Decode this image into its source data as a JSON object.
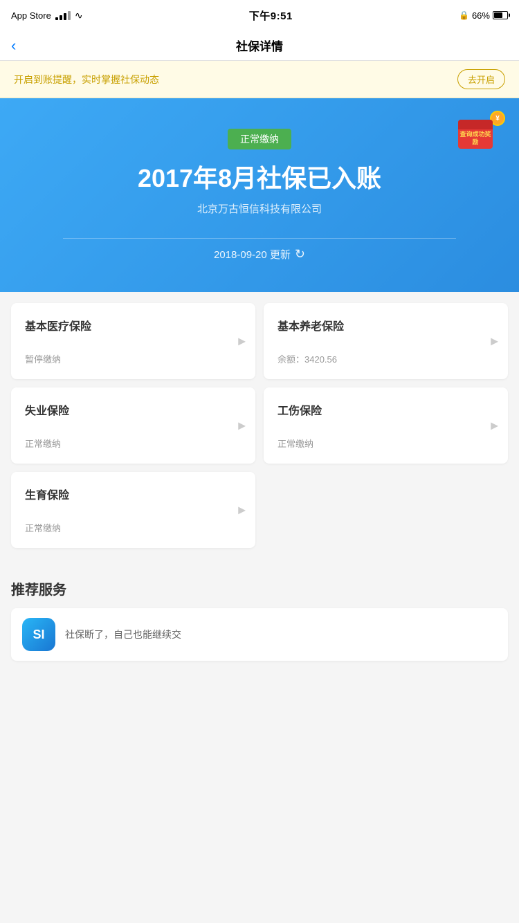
{
  "statusBar": {
    "appStore": "App Store",
    "time": "下午9:51",
    "battery": "66%",
    "batteryLevel": 66
  },
  "navBar": {
    "backLabel": "‹",
    "title": "社保详情"
  },
  "banner": {
    "text": "开启到账提醒，实时掌握社保动态",
    "buttonLabel": "去开启"
  },
  "hero": {
    "statusBadge": "正常缴纳",
    "title": "2017年8月社保已入账",
    "company": "北京万古恒信科技有限公司",
    "updateDate": "2018-09-20 更新",
    "rewardText": "查询成功奖励"
  },
  "insuranceCards": [
    {
      "id": "medical",
      "title": "基本医疗保险",
      "status": "暂停缴纳",
      "balance": null
    },
    {
      "id": "pension",
      "title": "基本养老保险",
      "status": "余额：3420.56",
      "balance": "3420.56"
    },
    {
      "id": "unemployment",
      "title": "失业保险",
      "status": "正常缴纳",
      "balance": null
    },
    {
      "id": "workinjury",
      "title": "工伤保险",
      "status": "正常缴纳",
      "balance": null
    },
    {
      "id": "maternity",
      "title": "生育保险",
      "status": "正常缴纳",
      "balance": null
    }
  ],
  "recommend": {
    "sectionTitle": "推荐服务",
    "items": [
      {
        "iconText": "SI",
        "text": "社保断了，自己也能继续交"
      }
    ]
  }
}
